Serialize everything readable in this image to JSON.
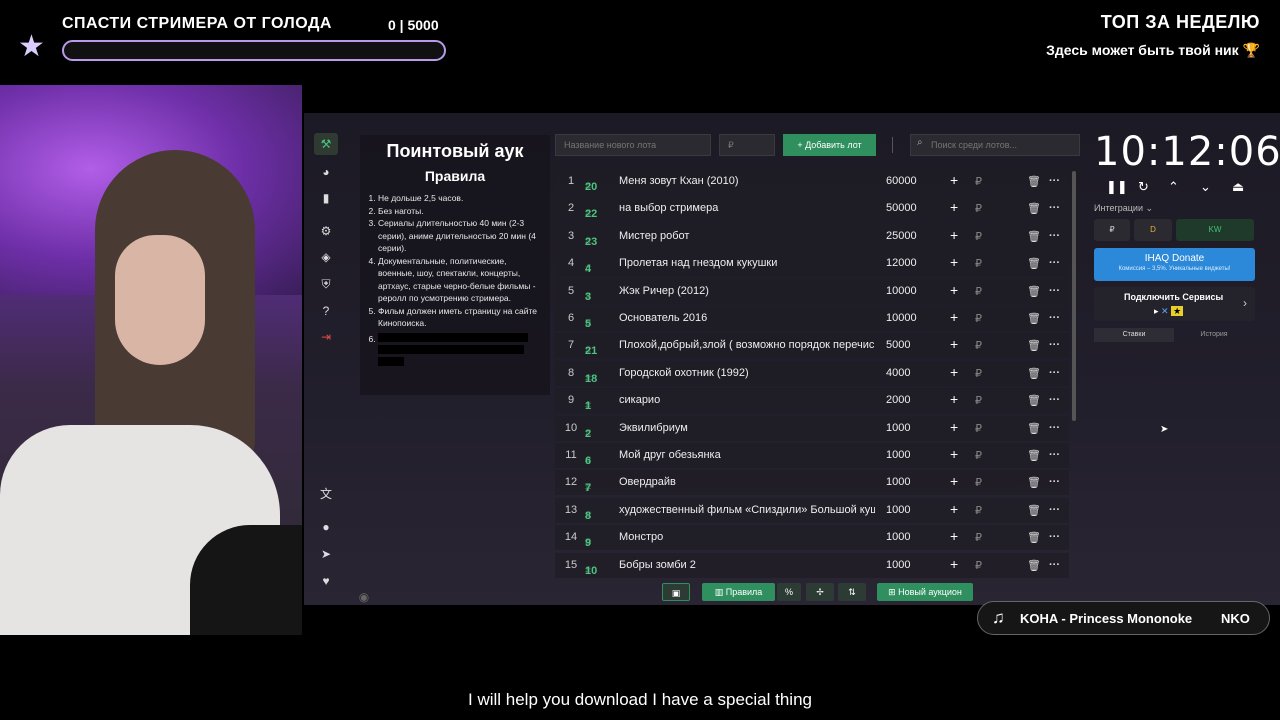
{
  "goal": {
    "title": "СПАСТИ СТРИМЕРА ОТ ГОЛОДА",
    "count": "0 | 5000",
    "progress": 0
  },
  "top_week": {
    "title": "ТОП ЗА НЕДЕЛЮ",
    "subtitle": "Здесь может быть твой ник",
    "trophy": "🏆"
  },
  "rules": {
    "title": "Поинтовый аук",
    "subtitle": "Правила",
    "items": [
      "Не дольше 2,5 часов.",
      "Без наготы.",
      "Сериалы длительностью 40 мин (2-3 серии), аниме длительностью 20 мин (4 серии).",
      "Документальные, политические, военные, шоу, спектакли, концерты, артхаус, старые черно-белые фильмы - реролл по усмотрению стримера.",
      "Фильм должен иметь страницу на сайте Кинопоиска.",
      ""
    ]
  },
  "toolbar": {
    "lot_name_placeholder": "Название нового лота",
    "price_placeholder": "₽",
    "add_lot": "+  Добавить лот",
    "search_placeholder": "Поиск среди лотов..."
  },
  "lots": [
    {
      "num": "1",
      "id": "20",
      "name": "Меня зовут Кхан (2010)",
      "amount": "60000"
    },
    {
      "num": "2",
      "id": "22",
      "name": "на выбор стримера",
      "amount": "50000"
    },
    {
      "num": "3",
      "id": "23",
      "name": "Мистер робот",
      "amount": "25000"
    },
    {
      "num": "4",
      "id": "4",
      "name": "Пролетая над гнездом кукушки",
      "amount": "12000"
    },
    {
      "num": "5",
      "id": "3",
      "name": "Жэк Ричер (2012)",
      "amount": "10000"
    },
    {
      "num": "6",
      "id": "5",
      "name": "Основатель 2016",
      "amount": "10000"
    },
    {
      "num": "7",
      "id": "21",
      "name": "Плохой,добрый,злой ( возможно порядок перечис.",
      "amount": "5000"
    },
    {
      "num": "8",
      "id": "18",
      "name": "Городской охотник (1992)",
      "amount": "4000"
    },
    {
      "num": "9",
      "id": "1",
      "name": "сикарио",
      "amount": "2000"
    },
    {
      "num": "10",
      "id": "2",
      "name": "Эквилибриум",
      "amount": "1000"
    },
    {
      "num": "11",
      "id": "6",
      "name": "Мой друг обезьянка",
      "amount": "1000"
    },
    {
      "num": "12",
      "id": "7",
      "name": "Овердрайв",
      "amount": "1000"
    },
    {
      "num": "13",
      "id": "8",
      "name": "художественный фильм «Спиздили» Большой куш",
      "amount": "1000"
    },
    {
      "num": "14",
      "id": "9",
      "name": "Монстро",
      "amount": "1000"
    },
    {
      "num": "15",
      "id": "10",
      "name": "Бобры зомби 2",
      "amount": "1000"
    }
  ],
  "row_glyphs": {
    "hash": "#",
    "plus": "+",
    "currency": "₽",
    "delete": "🗑",
    "more": "···"
  },
  "bottom": {
    "rules": "Правила",
    "percent": "%",
    "new_auction": "Новый аукцион"
  },
  "timer": {
    "value": "10:12:06"
  },
  "integrations": {
    "label": "Интеграции ⌄",
    "currency": "₽",
    "tag_a": "D",
    "tag_b": "KW"
  },
  "donate": {
    "title": "IHAQ Donate",
    "sub": "Комиссия – 3,5%. Уникальные виджеты!"
  },
  "services": {
    "title": "Подключить Сервисы"
  },
  "tabs": {
    "bets": "Ставки",
    "history": "История"
  },
  "music": {
    "text": "KOHA - Princess Mononoke",
    "text2": "NKO"
  },
  "subtitle": "I will help you download I have a special thing",
  "colors": {
    "accent": "#2f8f5e",
    "goal": "#b99be9",
    "donate": "#2c88d8"
  }
}
